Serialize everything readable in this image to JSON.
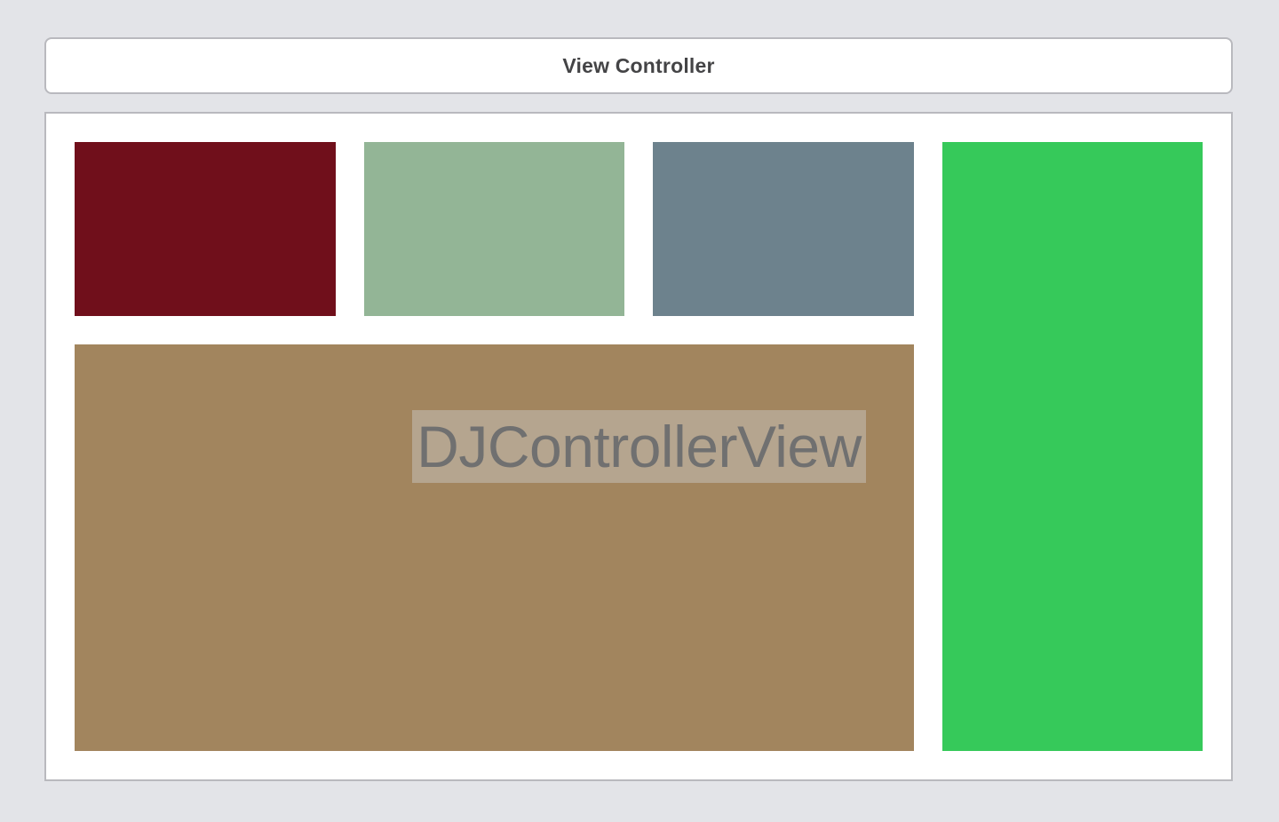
{
  "header": {
    "title": "View Controller"
  },
  "views": {
    "top_left": {
      "color": "#700f1b"
    },
    "top_middle": {
      "color": "#93b596"
    },
    "top_right": {
      "color": "#6d828d"
    },
    "right_column": {
      "color": "#36c95a"
    },
    "main": {
      "color": "#a2855e",
      "label": "DJControllerView"
    }
  }
}
